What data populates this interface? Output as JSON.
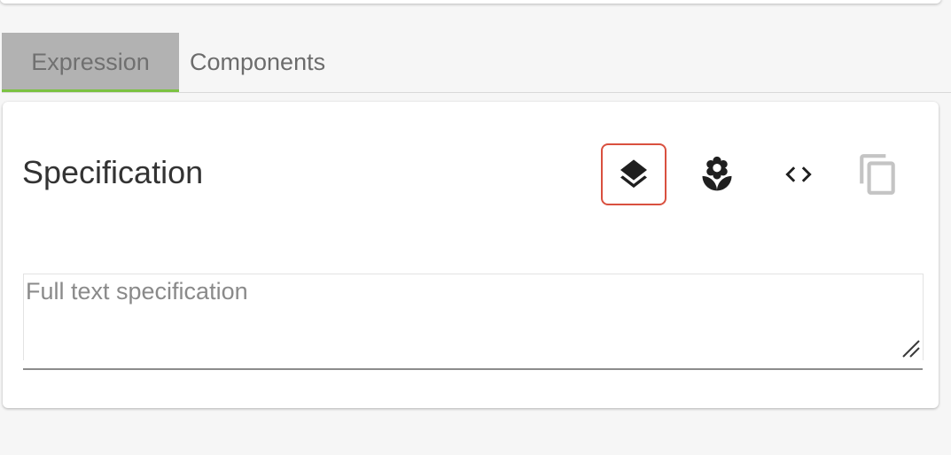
{
  "tabs": [
    {
      "label": "Expression",
      "active": true
    },
    {
      "label": "Components",
      "active": false
    }
  ],
  "card": {
    "title": "Specification",
    "toolbar": {
      "layers_icon": "layers-icon",
      "flower_icon": "flower-icon",
      "code_icon": "code-icon",
      "copy_icon": "copy-icon"
    },
    "textarea": {
      "placeholder": "Full text specification",
      "value": ""
    }
  },
  "colors": {
    "accent_green": "#7cc242",
    "highlight_red": "#d9503f",
    "tab_active_bg": "#b2b2b2"
  }
}
